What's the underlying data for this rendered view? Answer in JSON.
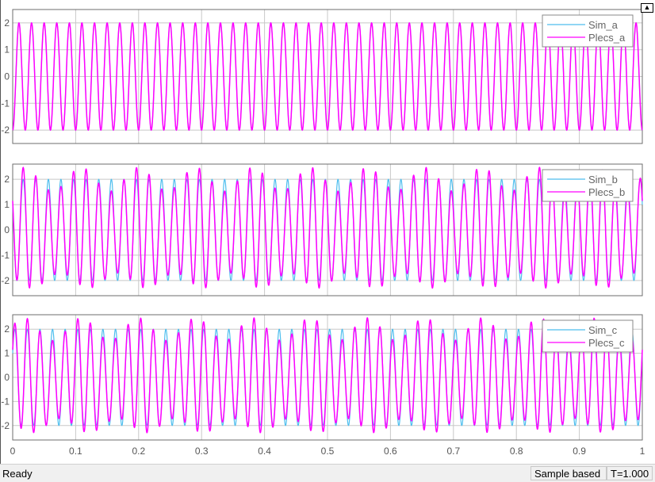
{
  "status": {
    "ready": "Ready",
    "mode": "Sample based",
    "time": "T=1.000"
  },
  "colors": {
    "sim": "#4dbeee",
    "plecs": "#ff00ff",
    "grid": "#c8c8c8",
    "axis": "#6e6e6e"
  },
  "chart_data": [
    {
      "type": "line",
      "xlim": [
        0,
        1
      ],
      "ylim": [
        -2.5,
        2.5
      ],
      "grid": true,
      "legend": "top-right",
      "xticks": [
        "0",
        "0.1",
        "0.2",
        "0.3",
        "0.4",
        "0.5",
        "0.6",
        "0.7",
        "0.8",
        "0.9",
        "1"
      ],
      "yticks": [
        "2",
        "1",
        "0",
        "-1",
        "-2"
      ],
      "series": [
        {
          "name": "Sim_a",
          "frequency_hz": 50,
          "amplitude": 2,
          "phase_deg": -90
        },
        {
          "name": "Plecs_a",
          "frequency_hz": 50,
          "amplitude": 2,
          "phase_deg": -90
        }
      ]
    },
    {
      "type": "line",
      "xlim": [
        0,
        1
      ],
      "ylim": [
        -2.6,
        2.6
      ],
      "grid": true,
      "legend": "top-right",
      "xticks": [
        "0",
        "0.1",
        "0.2",
        "0.3",
        "0.4",
        "0.5",
        "0.6",
        "0.7",
        "0.8",
        "0.9",
        "1"
      ],
      "yticks": [
        "2",
        "1",
        "0",
        "-1",
        "-2"
      ],
      "series": [
        {
          "name": "Sim_b",
          "frequency_hz": 50,
          "amplitude": 2,
          "phase_deg": 150
        },
        {
          "name": "Plecs_b",
          "frequency_hz": 50,
          "amplitude": 2,
          "phase_deg": 150,
          "ripple_amplitude": 0.35,
          "ripple_hz": 11
        }
      ]
    },
    {
      "type": "line",
      "xlim": [
        0,
        1
      ],
      "ylim": [
        -2.6,
        2.6
      ],
      "grid": true,
      "legend": "top-right",
      "xticks": [
        "0",
        "0.1",
        "0.2",
        "0.3",
        "0.4",
        "0.5",
        "0.6",
        "0.7",
        "0.8",
        "0.9",
        "1"
      ],
      "yticks": [
        "2",
        "1",
        "0",
        "-1",
        "-2"
      ],
      "series": [
        {
          "name": "Sim_c",
          "frequency_hz": 50,
          "amplitude": 2,
          "phase_deg": 30
        },
        {
          "name": "Plecs_c",
          "frequency_hz": 50,
          "amplitude": 2,
          "phase_deg": 30,
          "ripple_amplitude": 0.35,
          "ripple_hz": 11
        }
      ]
    }
  ]
}
